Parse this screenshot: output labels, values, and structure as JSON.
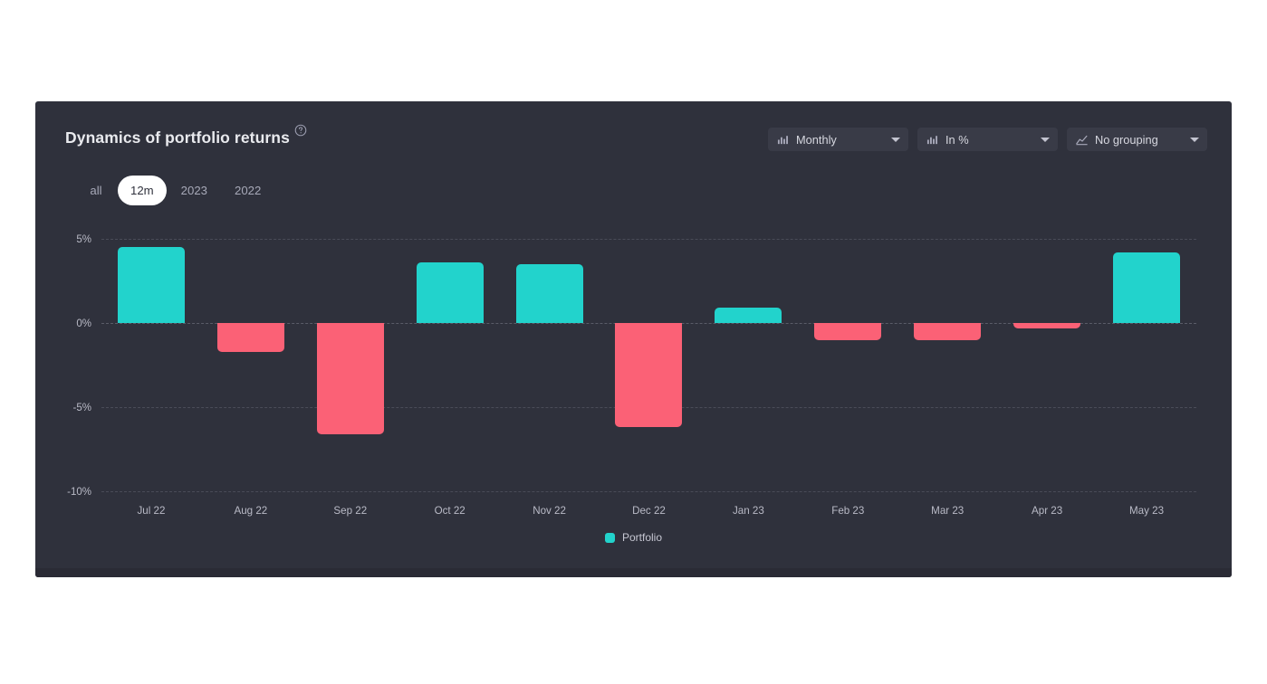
{
  "panel": {
    "title": "Dynamics of portfolio returns",
    "help_icon": "help-circle-icon"
  },
  "controls": {
    "period": {
      "label": "Monthly",
      "icon": "bar-chart-icon"
    },
    "units": {
      "label": "In %",
      "icon": "bar-chart-icon"
    },
    "grouping": {
      "label": "No grouping",
      "icon": "line-chart-icon"
    }
  },
  "range_tabs": [
    {
      "label": "all",
      "active": false
    },
    {
      "label": "12m",
      "active": true
    },
    {
      "label": "2023",
      "active": false
    },
    {
      "label": "2022",
      "active": false
    }
  ],
  "colors": {
    "positive": "#22d3cc",
    "negative": "#fb6176",
    "panel_bg": "#2f313c",
    "page_bg": "#ffffff",
    "grid": "#4a4c58",
    "text_muted": "#b9bac6"
  },
  "chart_data": {
    "type": "bar",
    "title": "Dynamics of portfolio returns",
    "xlabel": "",
    "ylabel": "",
    "ylim": [
      -10,
      5
    ],
    "yticks": [
      "5%",
      "0%",
      "-5%",
      "-10%"
    ],
    "ytick_values": [
      5,
      0,
      -5,
      -10
    ],
    "grid": true,
    "legend": [
      {
        "name": "Portfolio",
        "color": "#22d3cc"
      }
    ],
    "legend_position": "bottom-center",
    "categories": [
      "Jul 22",
      "Aug 22",
      "Sep 22",
      "Oct 22",
      "Nov 22",
      "Dec 22",
      "Jan 23",
      "Feb 23",
      "Mar 23",
      "Apr 23",
      "May 23"
    ],
    "series": [
      {
        "name": "Portfolio",
        "values": [
          4.5,
          -1.7,
          -6.6,
          3.6,
          3.5,
          -6.2,
          0.9,
          -1.0,
          -1.0,
          -0.3,
          4.2
        ]
      }
    ]
  }
}
